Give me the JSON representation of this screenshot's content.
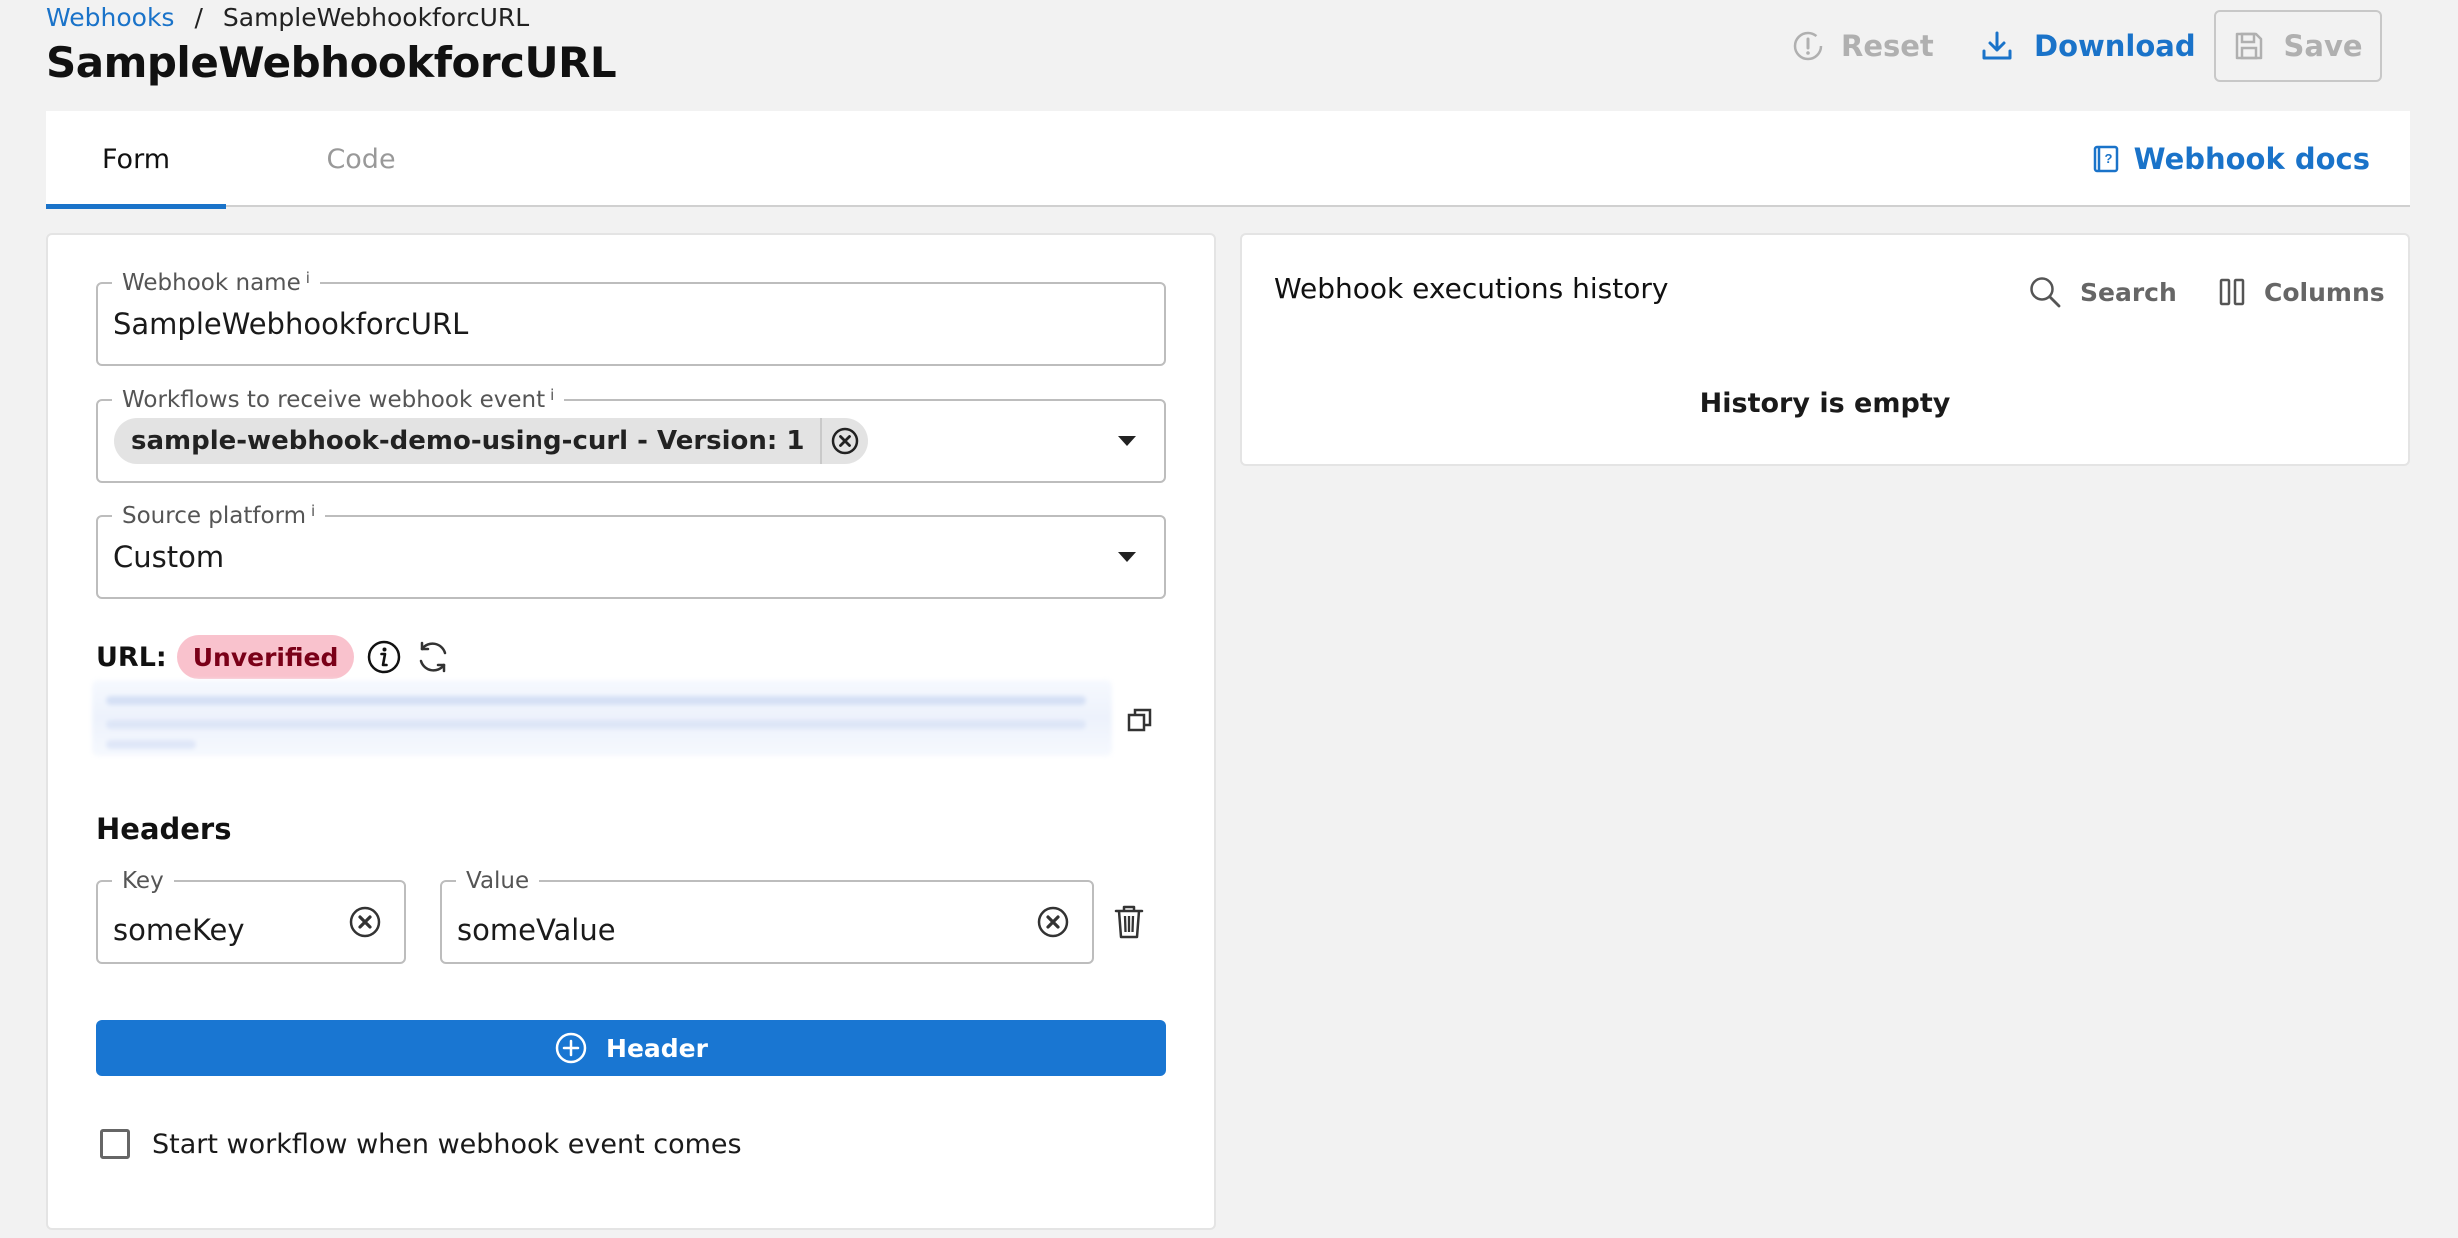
{
  "breadcrumb": {
    "parent": "Webhooks",
    "separator": "/",
    "current": "SampleWebhookforcURL"
  },
  "page": {
    "title": "SampleWebhookforcURL"
  },
  "actions": {
    "reset": "Reset",
    "download": "Download",
    "save": "Save"
  },
  "tabs": {
    "form": "Form",
    "code": "Code",
    "active": "Form"
  },
  "docs_link": "Webhook docs",
  "form": {
    "webhook_name": {
      "label": "Webhook name",
      "info": "i",
      "value": "SampleWebhookforcURL"
    },
    "workflows": {
      "label": "Workflows to receive webhook event",
      "info": "i",
      "chip": "sample-webhook-demo-using-curl - Version: 1"
    },
    "source_platform": {
      "label": "Source platform",
      "info": "i",
      "value": "Custom"
    },
    "url": {
      "label": "URL:",
      "status": "Unverified"
    },
    "headers": {
      "title": "Headers",
      "key_label": "Key",
      "key_value": "someKey",
      "value_label": "Value",
      "value_value": "someValue",
      "add_button": "Header"
    },
    "start_workflow": {
      "label": "Start workflow when webhook event comes",
      "checked": false
    }
  },
  "history": {
    "title": "Webhook executions history",
    "search": "Search",
    "columns": "Columns",
    "empty": "History is empty"
  },
  "colors": {
    "accent": "#1a73c9",
    "primary_button": "#1976d2",
    "unverified_badge_bg": "#f9c2cd",
    "unverified_badge_text": "#7a0018",
    "disabled": "#b0b0b0"
  },
  "icons": {
    "reset": "alert-circle-icon",
    "download": "download-icon",
    "save": "floppy-disk-icon",
    "docs": "book-icon",
    "chip_remove": "close-circle-icon",
    "url_info": "info-icon",
    "url_refresh": "refresh-icon",
    "copy": "copy-icon",
    "clear": "close-circle-icon",
    "delete": "trash-icon",
    "add": "plus-circle-icon",
    "search": "search-icon",
    "columns": "columns-icon"
  }
}
